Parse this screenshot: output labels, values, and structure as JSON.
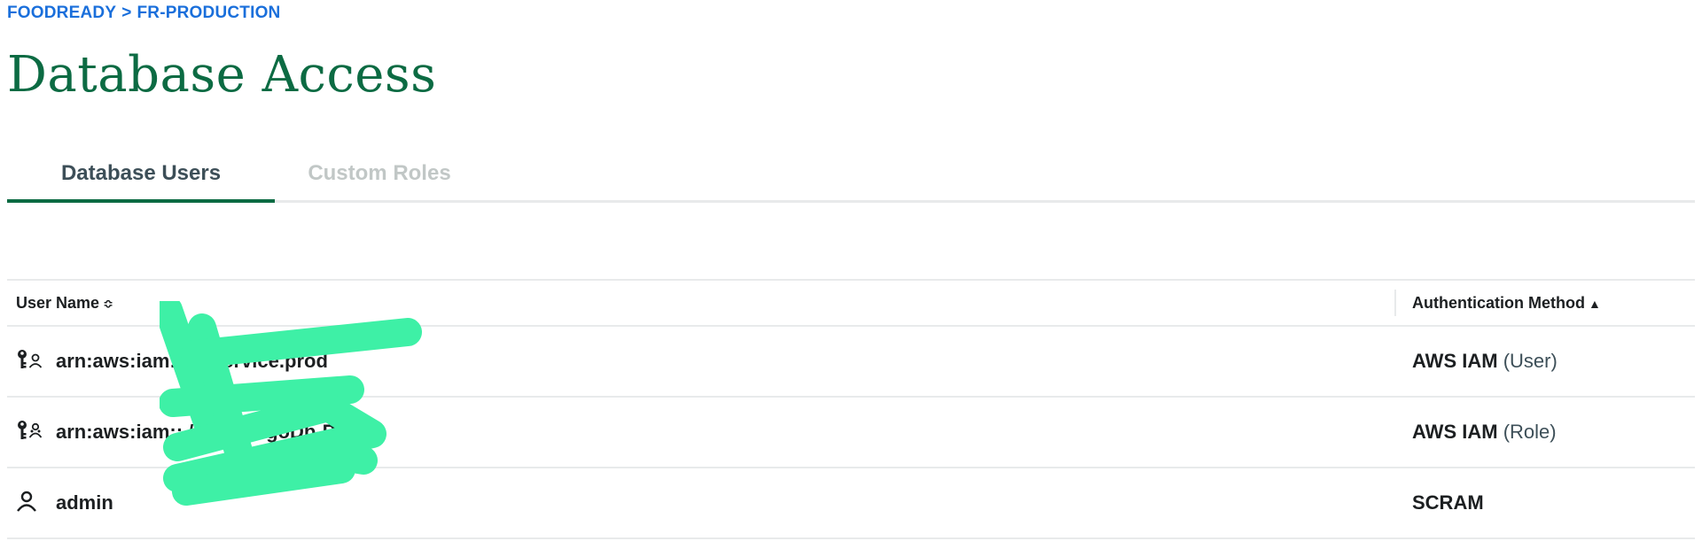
{
  "breadcrumb": {
    "org": "FOODREADY",
    "separator": ">",
    "project": "FR-PRODUCTION"
  },
  "page_title": "Database Access",
  "tabs": [
    {
      "label": "Database Users",
      "active": true
    },
    {
      "label": "Custom Roles",
      "active": false
    }
  ],
  "table": {
    "columns": {
      "user_name": "User Name",
      "user_name_sort": "≎",
      "auth_method": "Authentication Method",
      "auth_method_sort": "▲"
    },
    "rows": [
      {
        "icon": "key-user-icon",
        "user_name": "arn:aws:iam::         /fr.service.prod",
        "auth_method": "AWS IAM",
        "auth_detail": "(User)"
      },
      {
        "icon": "key-role-icon",
        "user_name": "arn:aws:iam::         /FR-MongoDb-Prod",
        "auth_method": "AWS IAM",
        "auth_detail": "(Role)"
      },
      {
        "icon": "person-icon",
        "user_name": "admin",
        "auth_method": "SCRAM",
        "auth_detail": ""
      }
    ]
  },
  "colors": {
    "brand_green": "#0c6b43",
    "link_blue": "#1a6fdb",
    "redaction_green": "#3ef0a6"
  }
}
